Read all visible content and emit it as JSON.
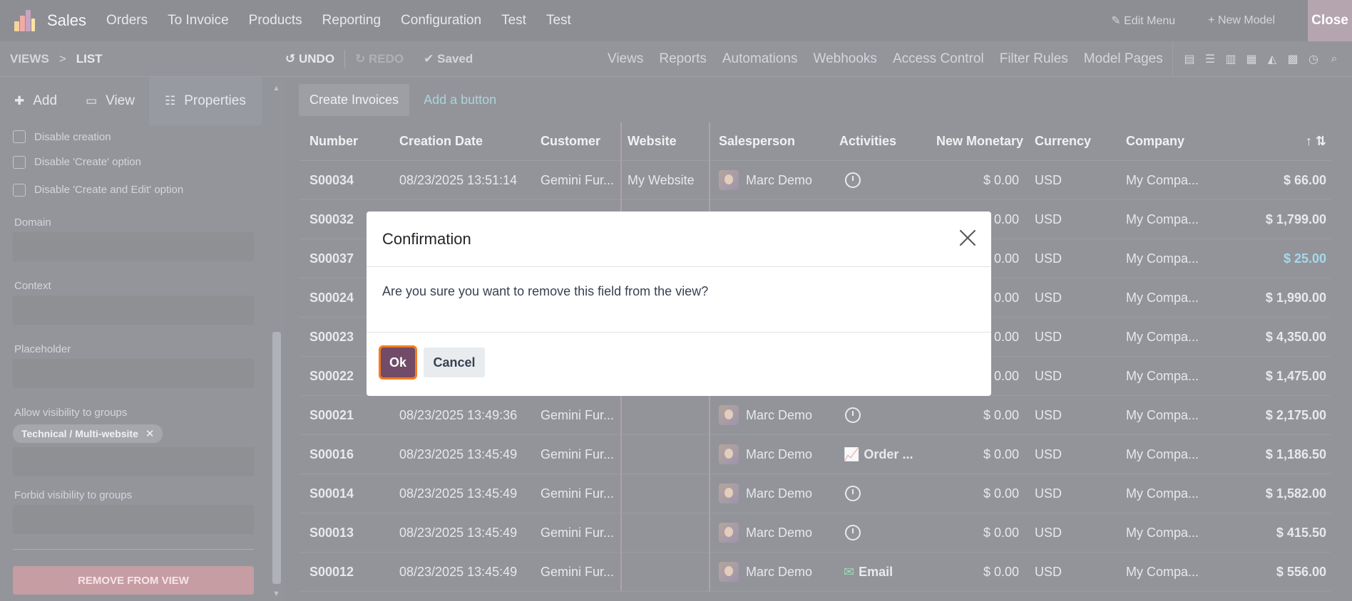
{
  "topnav": {
    "app_name": "Sales",
    "menu": [
      "Orders",
      "To Invoice",
      "Products",
      "Reporting",
      "Configuration",
      "Test",
      "Test"
    ],
    "edit_menu": "Edit Menu",
    "new_model": "New Model",
    "close": "Close"
  },
  "subbar": {
    "crumb_root": "VIEWS",
    "crumb_sep": ">",
    "crumb_current": "LIST",
    "undo": "UNDO",
    "redo": "REDO",
    "saved": "Saved",
    "links": [
      "Views",
      "Reports",
      "Automations",
      "Webhooks",
      "Access Control",
      "Filter Rules",
      "Model Pages"
    ]
  },
  "sidebar": {
    "tabs": [
      {
        "label": "Add",
        "icon": "plus-icon"
      },
      {
        "label": "View",
        "icon": "monitor-icon"
      },
      {
        "label": "Properties",
        "icon": "properties-icon"
      }
    ],
    "checkboxes": [
      "Disable creation",
      "Disable 'Create' option",
      "Disable 'Create and Edit' option"
    ],
    "domain_label": "Domain",
    "context_label": "Context",
    "placeholder_label": "Placeholder",
    "allow_groups_label": "Allow visibility to groups",
    "allow_group_tag": "Technical / Multi-website",
    "forbid_groups_label": "Forbid visibility to groups",
    "remove_button": "REMOVE FROM VIEW"
  },
  "main": {
    "create_invoices": "Create Invoices",
    "add_button": "Add a button",
    "columns": [
      "Number",
      "Creation Date",
      "Customer",
      "Website",
      "Salesperson",
      "Activities",
      "New Monetary",
      "Currency",
      "Company"
    ],
    "rows": [
      {
        "number": "S00034",
        "date": "08/23/2025 13:51:14",
        "customer": "Gemini Fur...",
        "website": "My Website",
        "sales": "Marc Demo",
        "activity": "clock",
        "activity_text": "",
        "monetary": "$ 0.00",
        "currency": "USD",
        "company": "My Compa...",
        "total": "$ 66.00"
      },
      {
        "number": "S00032",
        "date": "",
        "customer": "",
        "website": "",
        "sales": "",
        "activity": "",
        "activity_text": "",
        "monetary": "$ 0.00",
        "currency": "USD",
        "company": "My Compa...",
        "total": "$ 1,799.00"
      },
      {
        "number": "S00037",
        "date": "",
        "customer": "",
        "website": "",
        "sales": "",
        "activity": "",
        "activity_text": "",
        "monetary": "$ 0.00",
        "currency": "USD",
        "company": "My Compa...",
        "total": "$ 25.00"
      },
      {
        "number": "S00024",
        "date": "",
        "customer": "",
        "website": "",
        "sales": "",
        "activity": "",
        "activity_text": "",
        "monetary": "$ 0.00",
        "currency": "USD",
        "company": "My Compa...",
        "total": "$ 1,990.00"
      },
      {
        "number": "S00023",
        "date": "",
        "customer": "",
        "website": "",
        "sales": "",
        "activity": "",
        "activity_text": "",
        "monetary": "$ 0.00",
        "currency": "USD",
        "company": "My Compa...",
        "total": "$ 4,350.00"
      },
      {
        "number": "S00022",
        "date": "",
        "customer": "",
        "website": "",
        "sales": "",
        "activity": "",
        "activity_text": "",
        "monetary": "$ 0.00",
        "currency": "USD",
        "company": "My Compa...",
        "total": "$ 1,475.00"
      },
      {
        "number": "S00021",
        "date": "08/23/2025 13:49:36",
        "customer": "Gemini Fur...",
        "website": "",
        "sales": "Marc Demo",
        "activity": "clock",
        "activity_text": "",
        "monetary": "$ 0.00",
        "currency": "USD",
        "company": "My Compa...",
        "total": "$ 2,175.00"
      },
      {
        "number": "S00016",
        "date": "08/23/2025 13:45:49",
        "customer": "Gemini Fur...",
        "website": "",
        "sales": "Marc Demo",
        "activity": "chart",
        "activity_text": "Order ...",
        "monetary": "$ 0.00",
        "currency": "USD",
        "company": "My Compa...",
        "total": "$ 1,186.50"
      },
      {
        "number": "S00014",
        "date": "08/23/2025 13:45:49",
        "customer": "Gemini Fur...",
        "website": "",
        "sales": "Marc Demo",
        "activity": "clock",
        "activity_text": "",
        "monetary": "$ 0.00",
        "currency": "USD",
        "company": "My Compa...",
        "total": "$ 1,582.00"
      },
      {
        "number": "S00013",
        "date": "08/23/2025 13:45:49",
        "customer": "Gemini Fur...",
        "website": "",
        "sales": "Marc Demo",
        "activity": "clock",
        "activity_text": "",
        "monetary": "$ 0.00",
        "currency": "USD",
        "company": "My Compa...",
        "total": "$ 415.50"
      },
      {
        "number": "S00012",
        "date": "08/23/2025 13:45:49",
        "customer": "Gemini Fur...",
        "website": "",
        "sales": "Marc Demo",
        "activity": "email",
        "activity_text": "Email",
        "monetary": "$ 0.00",
        "currency": "USD",
        "company": "My Compa...",
        "total": "$ 556.00"
      }
    ]
  },
  "dialog": {
    "title": "Confirmation",
    "message": "Are you sure you want to remove this field from the view?",
    "ok": "Ok",
    "cancel": "Cancel"
  },
  "colors": {
    "accent": "#714b67",
    "focus_ring": "#f57c20",
    "danger": "#8b3a47"
  }
}
